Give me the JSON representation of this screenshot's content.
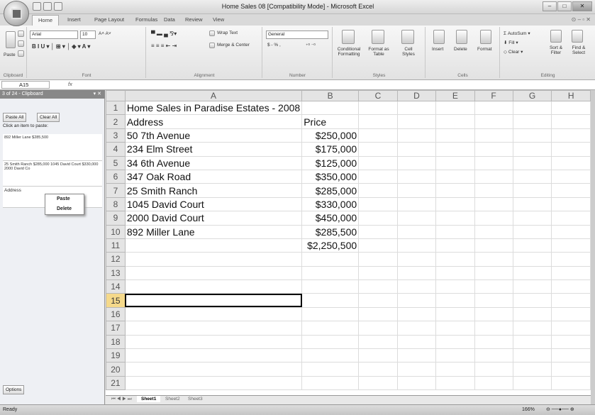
{
  "window": {
    "title": "Home Sales 08  [Compatibility Mode] - Microsoft Excel"
  },
  "tabs": [
    "Home",
    "Insert",
    "Page Layout",
    "Formulas",
    "Data",
    "Review",
    "View"
  ],
  "ribbon": {
    "clipboard": {
      "paste": "Paste",
      "label": "Clipboard"
    },
    "font": {
      "name": "Arial",
      "size": "10",
      "label": "Font"
    },
    "alignment": {
      "wrap": "Wrap Text",
      "merge": "Merge & Center",
      "label": "Alignment"
    },
    "number": {
      "format": "General",
      "currency": "$ - % ,",
      "label": "Number"
    },
    "styles": {
      "cond": "Conditional Formatting",
      "fmt_table": "Format as Table",
      "cell_styles": "Cell Styles",
      "label": "Styles"
    },
    "cells": {
      "insert": "Insert",
      "delete": "Delete",
      "format": "Format",
      "label": "Cells"
    },
    "editing": {
      "autosum": "AutoSum",
      "fill": "Fill",
      "clear": "Clear",
      "sort": "Sort & Filter",
      "find": "Find & Select",
      "label": "Editing"
    }
  },
  "formula_bar": {
    "name_box": "A15",
    "fx": "fx",
    "formula": ""
  },
  "clipboard_pane": {
    "title": "3 of 24 - Clipboard",
    "paste_all": "Paste All",
    "clear_all": "Clear All",
    "instruction": "Click an item to paste:",
    "items": [
      "892 Miller Lane $285,500",
      "25 Smith Ranch $285,000 1045 David Court $330,000 2000 David Co",
      "Address"
    ],
    "menu": {
      "paste": "Paste",
      "delete": "Delete"
    },
    "options": "Options"
  },
  "sheet": {
    "columns": [
      "A",
      "B",
      "C",
      "D",
      "E",
      "F",
      "G",
      "H"
    ],
    "rows": [
      [
        "Home Sales in Paradise Estates - 2008",
        ""
      ],
      [
        "Address",
        "Price"
      ],
      [
        "50 7th Avenue",
        "$250,000"
      ],
      [
        "234 Elm Street",
        "$175,000"
      ],
      [
        "34 6th Avenue",
        "$125,000"
      ],
      [
        "347 Oak Road",
        "$350,000"
      ],
      [
        "25 Smith Ranch",
        "$285,000"
      ],
      [
        "1045 David Court",
        "$330,000"
      ],
      [
        "2000 David Court",
        "$450,000"
      ],
      [
        "892 Miller Lane",
        "$285,500"
      ],
      [
        "",
        "$2,250,500"
      ],
      [
        "",
        ""
      ],
      [
        "",
        ""
      ],
      [
        "",
        ""
      ],
      [
        "",
        ""
      ],
      [
        "",
        ""
      ],
      [
        "",
        ""
      ],
      [
        "",
        ""
      ],
      [
        "",
        ""
      ],
      [
        "",
        ""
      ],
      [
        "",
        ""
      ]
    ],
    "active_cell": "A15",
    "tabs": [
      "Sheet1",
      "Sheet2",
      "Sheet3"
    ]
  },
  "status": {
    "ready": "Ready",
    "zoom": "166%"
  }
}
